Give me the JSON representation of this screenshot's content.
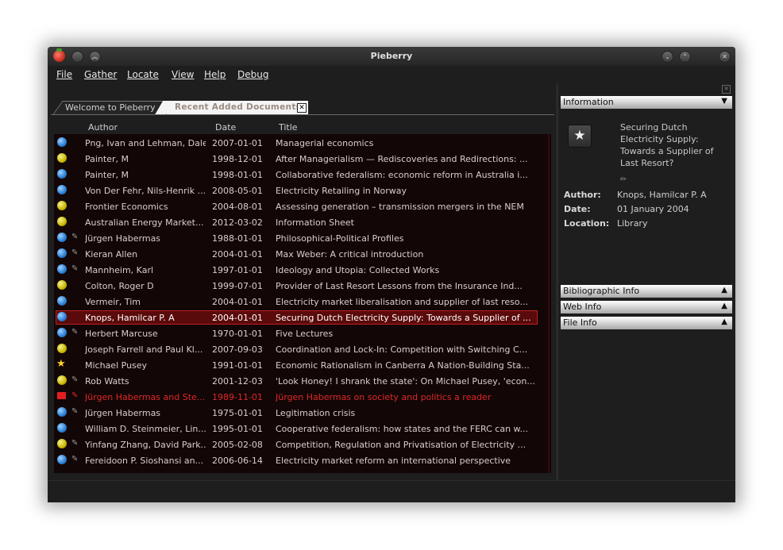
{
  "window": {
    "title": "Pieberry"
  },
  "menu": [
    "File",
    "Gather",
    "Locate",
    "View",
    "Help",
    "Debug"
  ],
  "tabs": [
    {
      "label": "Welcome to Pieberry",
      "active": false
    },
    {
      "label": "Recent Added Documents",
      "active": true
    }
  ],
  "columns": {
    "author": "Author",
    "date": "Date",
    "title": "Title"
  },
  "rows": [
    {
      "icon": "blue",
      "pen": false,
      "author": "Png, Ivan and Lehman, Dale",
      "date": "2007-01-01",
      "title": "Managerial economics"
    },
    {
      "icon": "yellow",
      "pen": false,
      "author": "Painter, M",
      "date": "1998-12-01",
      "title": "After Managerialism — Rediscoveries and Redirections: ..."
    },
    {
      "icon": "blue",
      "pen": false,
      "author": "Painter, M",
      "date": "1998-01-01",
      "title": "Collaborative federalism: economic reform in Australia i..."
    },
    {
      "icon": "blue",
      "pen": false,
      "author": "Von Der Fehr, Nils-Henrik ...",
      "date": "2008-05-01",
      "title": "Electricity Retailing in Norway"
    },
    {
      "icon": "yellow",
      "pen": false,
      "author": "Frontier Economics",
      "date": "2004-08-01",
      "title": "Assessing generation – transmission mergers in the NEM"
    },
    {
      "icon": "yellow",
      "pen": false,
      "author": "Australian Energy Market...",
      "date": "2012-03-02",
      "title": "Information Sheet"
    },
    {
      "icon": "blue",
      "pen": true,
      "author": "Jürgen Habermas",
      "date": "1988-01-01",
      "title": "Philosophical-Political Profiles"
    },
    {
      "icon": "blue",
      "pen": true,
      "author": "Kieran Allen",
      "date": "2004-01-01",
      "title": "Max Weber: A critical introduction"
    },
    {
      "icon": "blue",
      "pen": true,
      "author": "Mannheim, Karl",
      "date": "1997-01-01",
      "title": "Ideology and Utopia: Collected Works"
    },
    {
      "icon": "yellow",
      "pen": false,
      "author": "Colton, Roger D",
      "date": "1999-07-01",
      "title": "Provider of Last Resort Lessons from the Insurance Ind..."
    },
    {
      "icon": "blue",
      "pen": false,
      "author": "Vermeir, Tim",
      "date": "2004-01-01",
      "title": "Electricity market liberalisation and supplier of last reso..."
    },
    {
      "icon": "blue",
      "pen": false,
      "author": "Knops, Hamilcar P. A",
      "date": "2004-01-01",
      "title": "Securing Dutch Electricity Supply: Towards a Supplier of ...",
      "selected": true
    },
    {
      "icon": "blue",
      "pen": true,
      "author": "Herbert Marcuse",
      "date": "1970-01-01",
      "title": "Five Lectures"
    },
    {
      "icon": "yellow",
      "pen": false,
      "author": "Joseph Farrell and Paul Kl...",
      "date": "2007-09-03",
      "title": "Coordination and Lock-In: Competition with Switching C..."
    },
    {
      "icon": "star",
      "pen": false,
      "author": "Michael Pusey",
      "date": "1991-01-01",
      "title": "Economic Rationalism in Canberra A Nation-Building Sta..."
    },
    {
      "icon": "yellow",
      "pen": true,
      "author": "Rob Watts",
      "date": "2001-12-03",
      "title": "'Look Honey! I shrank the state': On Michael Pusey, 'econ..."
    },
    {
      "icon": "flag",
      "pen": true,
      "author": "Jürgen Habermas and Ste...",
      "date": "1989-11-01",
      "title": "Jürgen Habermas on society and politics a reader",
      "flagged": true
    },
    {
      "icon": "blue",
      "pen": true,
      "author": "Jürgen Habermas",
      "date": "1975-01-01",
      "title": "Legitimation crisis"
    },
    {
      "icon": "blue",
      "pen": false,
      "author": "William D. Steinmeier, Lin...",
      "date": "1995-01-01",
      "title": "Cooperative federalism: how states and the FERC can w..."
    },
    {
      "icon": "yellow",
      "pen": true,
      "author": "Yinfang Zhang, David Park...",
      "date": "2005-02-08",
      "title": "Competition, Regulation and Privatisation of Electricity ..."
    },
    {
      "icon": "blue",
      "pen": true,
      "author": "Fereidoon P. Sioshansi an...",
      "date": "2006-06-14",
      "title": "Electricity market reform an international perspective"
    }
  ],
  "info_panel": {
    "section_label": "Information",
    "doc_title": "Securing Dutch Electricity Supply: Towards a Supplier of Last Resort?",
    "fields": [
      {
        "label": "Author:",
        "value": "Knops, Hamilcar P. A"
      },
      {
        "label": "Date:",
        "value": "01 January 2004"
      },
      {
        "label": "Location:",
        "value": "Library"
      }
    ],
    "sections": [
      "Bibliographic Info",
      "Web Info",
      "File Info"
    ]
  },
  "colors": {
    "window_bg": "#1e1e1e",
    "list_bg": "#120606",
    "selected_bg": "#5a0a0a",
    "selected_border": "#c02020",
    "flagged_text": "#e02828"
  }
}
